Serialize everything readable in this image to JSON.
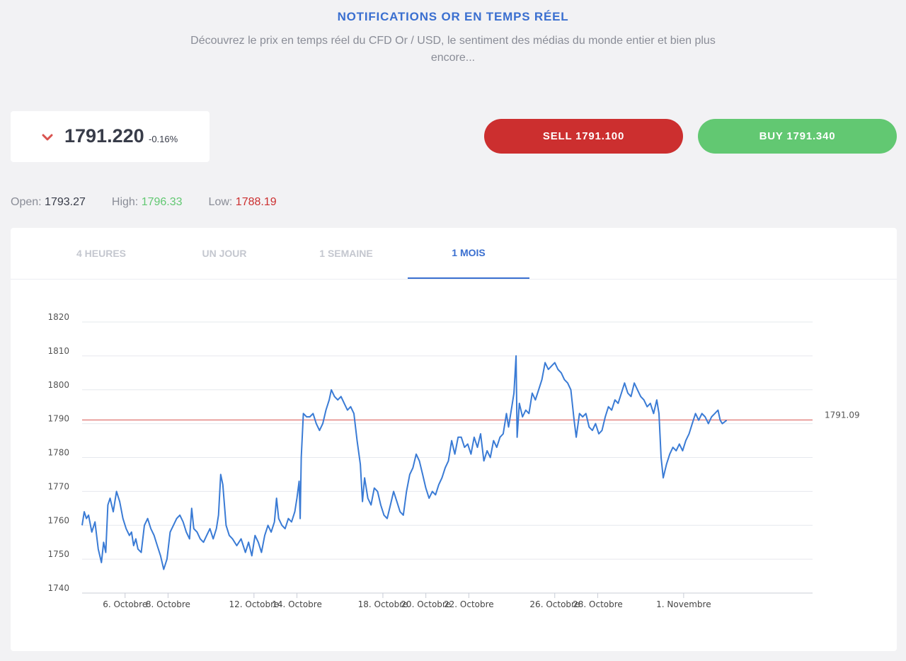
{
  "header": {
    "title": "NOTIFICATIONS OR EN TEMPS RÉEL",
    "subtitle": "Découvrez le prix en temps réel du CFD Or / USD, le sentiment des médias du monde entier et bien plus encore..."
  },
  "price": {
    "value": "1791.220",
    "change": "-0.16%",
    "direction_icon": "chevron-down-icon"
  },
  "actions": {
    "sell_label": "SELL 1791.100",
    "buy_label": "BUY 1791.340"
  },
  "stats": {
    "open_label": "Open:",
    "open_value": "1793.27",
    "high_label": "High:",
    "high_value": "1796.33",
    "low_label": "Low:",
    "low_value": "1788.19"
  },
  "tabs": [
    {
      "label": "4 HEURES",
      "active": false
    },
    {
      "label": "UN JOUR",
      "active": false
    },
    {
      "label": "1 SEMAINE",
      "active": false
    },
    {
      "label": "1 MOIS",
      "active": true
    }
  ],
  "colors": {
    "accent": "#3a6fd0",
    "sell": "#cc2f2f",
    "buy": "#62c872",
    "line": "#3a7bd5",
    "ref_line": "#d9534f"
  },
  "chart_data": {
    "type": "line",
    "ylim": [
      1740,
      1820
    ],
    "y_ticks": [
      1740,
      1750,
      1760,
      1770,
      1780,
      1790,
      1800,
      1810,
      1820
    ],
    "x_range": [
      4,
      38
    ],
    "x_ticks": [
      {
        "x": 6,
        "label": "6. Octobre"
      },
      {
        "x": 8,
        "label": "8. Octobre"
      },
      {
        "x": 12,
        "label": "12. Octobre"
      },
      {
        "x": 14,
        "label": "14. Octobre"
      },
      {
        "x": 18,
        "label": "18. Octobre"
      },
      {
        "x": 20,
        "label": "20. Octobre"
      },
      {
        "x": 22,
        "label": "22. Octobre"
      },
      {
        "x": 26,
        "label": "26. Octobre"
      },
      {
        "x": 28,
        "label": "28. Octobre"
      },
      {
        "x": 32,
        "label": "1. Novembre"
      }
    ],
    "reference": {
      "value": 1791.09,
      "label": "1791.09"
    },
    "grid": true,
    "series": [
      {
        "values": [
          [
            4.0,
            1760
          ],
          [
            4.1,
            1764
          ],
          [
            4.2,
            1762
          ],
          [
            4.3,
            1763
          ],
          [
            4.45,
            1758
          ],
          [
            4.6,
            1761
          ],
          [
            4.75,
            1753
          ],
          [
            4.9,
            1749
          ],
          [
            5.0,
            1755
          ],
          [
            5.1,
            1752
          ],
          [
            5.2,
            1766
          ],
          [
            5.3,
            1768
          ],
          [
            5.45,
            1764
          ],
          [
            5.6,
            1770
          ],
          [
            5.75,
            1767
          ],
          [
            5.9,
            1762
          ],
          [
            6.05,
            1759
          ],
          [
            6.2,
            1757
          ],
          [
            6.3,
            1758
          ],
          [
            6.4,
            1754
          ],
          [
            6.5,
            1756
          ],
          [
            6.6,
            1753
          ],
          [
            6.75,
            1752
          ],
          [
            6.9,
            1760
          ],
          [
            7.05,
            1762
          ],
          [
            7.2,
            1759
          ],
          [
            7.35,
            1757
          ],
          [
            7.5,
            1754
          ],
          [
            7.65,
            1751
          ],
          [
            7.8,
            1747
          ],
          [
            7.95,
            1750
          ],
          [
            8.1,
            1758
          ],
          [
            8.25,
            1760
          ],
          [
            8.4,
            1762
          ],
          [
            8.55,
            1763
          ],
          [
            8.7,
            1761
          ],
          [
            8.85,
            1758
          ],
          [
            9.0,
            1756
          ],
          [
            9.1,
            1765
          ],
          [
            9.2,
            1759
          ],
          [
            9.35,
            1758
          ],
          [
            9.5,
            1756
          ],
          [
            9.65,
            1755
          ],
          [
            9.8,
            1757
          ],
          [
            9.95,
            1759
          ],
          [
            10.1,
            1756
          ],
          [
            10.25,
            1759
          ],
          [
            10.35,
            1763
          ],
          [
            10.45,
            1775
          ],
          [
            10.55,
            1772
          ],
          [
            10.7,
            1760
          ],
          [
            10.85,
            1757
          ],
          [
            11.0,
            1756
          ],
          [
            11.2,
            1754
          ],
          [
            11.4,
            1756
          ],
          [
            11.6,
            1752
          ],
          [
            11.75,
            1755
          ],
          [
            11.9,
            1751
          ],
          [
            12.05,
            1757
          ],
          [
            12.2,
            1755
          ],
          [
            12.35,
            1752
          ],
          [
            12.5,
            1757
          ],
          [
            12.65,
            1760
          ],
          [
            12.8,
            1758
          ],
          [
            12.95,
            1761
          ],
          [
            13.05,
            1768
          ],
          [
            13.15,
            1762
          ],
          [
            13.3,
            1760
          ],
          [
            13.45,
            1759
          ],
          [
            13.6,
            1762
          ],
          [
            13.75,
            1761
          ],
          [
            13.9,
            1764
          ],
          [
            14.0,
            1768
          ],
          [
            14.1,
            1773
          ],
          [
            14.15,
            1762
          ],
          [
            14.2,
            1780
          ],
          [
            14.3,
            1793
          ],
          [
            14.45,
            1792
          ],
          [
            14.6,
            1792
          ],
          [
            14.75,
            1793
          ],
          [
            14.9,
            1790
          ],
          [
            15.05,
            1788
          ],
          [
            15.2,
            1790
          ],
          [
            15.35,
            1794
          ],
          [
            15.5,
            1797
          ],
          [
            15.6,
            1800
          ],
          [
            15.75,
            1798
          ],
          [
            15.9,
            1797
          ],
          [
            16.05,
            1798
          ],
          [
            16.2,
            1796
          ],
          [
            16.35,
            1794
          ],
          [
            16.5,
            1795
          ],
          [
            16.65,
            1793
          ],
          [
            16.8,
            1785
          ],
          [
            16.95,
            1778
          ],
          [
            17.05,
            1767
          ],
          [
            17.15,
            1774
          ],
          [
            17.3,
            1768
          ],
          [
            17.45,
            1766
          ],
          [
            17.6,
            1771
          ],
          [
            17.75,
            1770
          ],
          [
            17.9,
            1766
          ],
          [
            18.05,
            1763
          ],
          [
            18.2,
            1762
          ],
          [
            18.35,
            1766
          ],
          [
            18.5,
            1770
          ],
          [
            18.65,
            1767
          ],
          [
            18.8,
            1764
          ],
          [
            18.95,
            1763
          ],
          [
            19.1,
            1770
          ],
          [
            19.25,
            1775
          ],
          [
            19.4,
            1777
          ],
          [
            19.55,
            1781
          ],
          [
            19.7,
            1779
          ],
          [
            19.85,
            1775
          ],
          [
            20.0,
            1771
          ],
          [
            20.15,
            1768
          ],
          [
            20.3,
            1770
          ],
          [
            20.45,
            1769
          ],
          [
            20.6,
            1772
          ],
          [
            20.75,
            1774
          ],
          [
            20.9,
            1777
          ],
          [
            21.05,
            1779
          ],
          [
            21.2,
            1785
          ],
          [
            21.35,
            1781
          ],
          [
            21.5,
            1786
          ],
          [
            21.65,
            1786
          ],
          [
            21.8,
            1783
          ],
          [
            21.95,
            1784
          ],
          [
            22.1,
            1781
          ],
          [
            22.25,
            1786
          ],
          [
            22.4,
            1783
          ],
          [
            22.55,
            1787
          ],
          [
            22.7,
            1779
          ],
          [
            22.85,
            1782
          ],
          [
            23.0,
            1780
          ],
          [
            23.15,
            1785
          ],
          [
            23.3,
            1783
          ],
          [
            23.45,
            1786
          ],
          [
            23.6,
            1787
          ],
          [
            23.75,
            1793
          ],
          [
            23.85,
            1789
          ],
          [
            24.0,
            1795
          ],
          [
            24.1,
            1799
          ],
          [
            24.2,
            1810
          ],
          [
            24.25,
            1786
          ],
          [
            24.35,
            1796
          ],
          [
            24.5,
            1792
          ],
          [
            24.65,
            1794
          ],
          [
            24.8,
            1793
          ],
          [
            24.95,
            1799
          ],
          [
            25.1,
            1797
          ],
          [
            25.25,
            1800
          ],
          [
            25.4,
            1803
          ],
          [
            25.55,
            1808
          ],
          [
            25.7,
            1806
          ],
          [
            25.85,
            1807
          ],
          [
            26.0,
            1808
          ],
          [
            26.15,
            1806
          ],
          [
            26.3,
            1805
          ],
          [
            26.45,
            1803
          ],
          [
            26.6,
            1802
          ],
          [
            26.75,
            1800
          ],
          [
            26.9,
            1791
          ],
          [
            27.0,
            1786
          ],
          [
            27.15,
            1793
          ],
          [
            27.3,
            1792
          ],
          [
            27.45,
            1793
          ],
          [
            27.6,
            1789
          ],
          [
            27.75,
            1788
          ],
          [
            27.9,
            1790
          ],
          [
            28.05,
            1787
          ],
          [
            28.2,
            1788
          ],
          [
            28.35,
            1792
          ],
          [
            28.5,
            1795
          ],
          [
            28.65,
            1794
          ],
          [
            28.8,
            1797
          ],
          [
            28.95,
            1796
          ],
          [
            29.1,
            1799
          ],
          [
            29.25,
            1802
          ],
          [
            29.4,
            1799
          ],
          [
            29.55,
            1798
          ],
          [
            29.7,
            1802
          ],
          [
            29.85,
            1800
          ],
          [
            30.0,
            1798
          ],
          [
            30.15,
            1797
          ],
          [
            30.3,
            1795
          ],
          [
            30.45,
            1796
          ],
          [
            30.6,
            1793
          ],
          [
            30.75,
            1797
          ],
          [
            30.85,
            1793
          ],
          [
            30.95,
            1780
          ],
          [
            31.05,
            1774
          ],
          [
            31.2,
            1778
          ],
          [
            31.35,
            1781
          ],
          [
            31.5,
            1783
          ],
          [
            31.65,
            1782
          ],
          [
            31.8,
            1784
          ],
          [
            31.95,
            1782
          ],
          [
            32.1,
            1785
          ],
          [
            32.25,
            1787
          ],
          [
            32.4,
            1790
          ],
          [
            32.55,
            1793
          ],
          [
            32.7,
            1791
          ],
          [
            32.85,
            1793
          ],
          [
            33.0,
            1792
          ],
          [
            33.15,
            1790
          ],
          [
            33.3,
            1792
          ],
          [
            33.45,
            1793
          ],
          [
            33.6,
            1794
          ],
          [
            33.7,
            1791
          ],
          [
            33.8,
            1790
          ],
          [
            34.0,
            1791
          ]
        ]
      }
    ]
  }
}
